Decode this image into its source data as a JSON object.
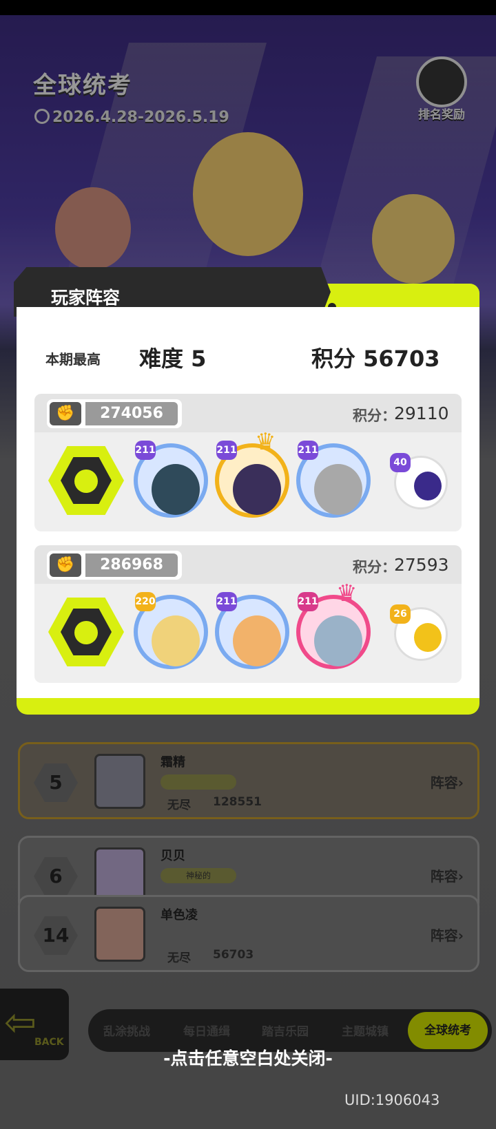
{
  "background": {
    "title": "全球统考",
    "date_range": "2026.4.28-2026.5.19",
    "reward_label": "排名奖励"
  },
  "modal": {
    "title": "玩家阵容",
    "best_label": "本期最高",
    "best_difficulty": "难度 5",
    "best_score": "积分 56703",
    "teams": [
      {
        "power": "274056",
        "score_label": "积分：",
        "score": "29110",
        "heroes": [
          {
            "level": "211",
            "frame": "blue"
          },
          {
            "level": "211",
            "frame": "gold",
            "crowned": true
          },
          {
            "level": "211",
            "frame": "blue"
          }
        ],
        "pet_level": "40"
      },
      {
        "power": "286968",
        "score_label": "积分：",
        "score": "27593",
        "heroes": [
          {
            "level": "220",
            "frame": "blue"
          },
          {
            "level": "211",
            "frame": "blue"
          },
          {
            "level": "211",
            "frame": "pink",
            "crowned": true
          }
        ],
        "pet_level": "26"
      }
    ]
  },
  "ranking_rows": [
    {
      "rank": "5",
      "name": "霜精",
      "mode": "无尽",
      "score": "128551",
      "lineup": "阵容"
    },
    {
      "rank": "6",
      "name": "贝贝",
      "badge": "神秘的",
      "lineup": "阵容"
    },
    {
      "rank": "14",
      "name": "单色凌",
      "mode": "无尽",
      "score": "56703",
      "lineup": "阵容"
    }
  ],
  "back_label": "BACK",
  "nav_tabs": [
    "乱涂挑战",
    "每日通缉",
    "踏吉乐园",
    "主题城镇",
    "全球统考"
  ],
  "close_hint": "-点击任意空白处关闭-",
  "uid": "UID:1906043",
  "colors": {
    "accent_lime": "#d8ef10",
    "dark": "#2a2a2a"
  }
}
